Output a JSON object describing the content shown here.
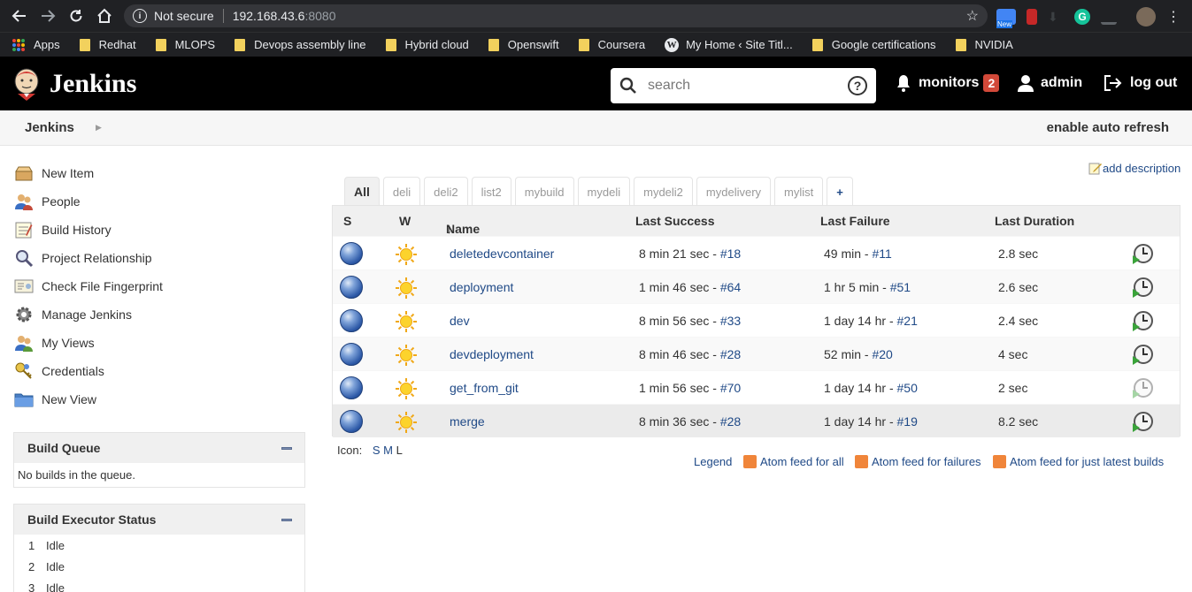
{
  "browser": {
    "security_label": "Not secure",
    "url_host": "192.168.43.6",
    "url_port": ":8080",
    "bookmarks": [
      {
        "label": "Apps",
        "icon": "apps-grid-icon"
      },
      {
        "label": "Redhat",
        "icon": "folder-icon"
      },
      {
        "label": "MLOPS",
        "icon": "folder-icon"
      },
      {
        "label": "Devops assembly line",
        "icon": "folder-icon"
      },
      {
        "label": "Hybrid cloud",
        "icon": "folder-icon"
      },
      {
        "label": "Openswift",
        "icon": "folder-icon"
      },
      {
        "label": "Coursera",
        "icon": "folder-icon"
      },
      {
        "label": "My Home ‹ Site Titl...",
        "icon": "wordpress-icon"
      },
      {
        "label": "Google certifications",
        "icon": "folder-icon"
      },
      {
        "label": "NVIDIA",
        "icon": "folder-icon"
      }
    ],
    "ext_new_label": "New"
  },
  "header": {
    "title": "Jenkins",
    "search_placeholder": "search",
    "help_glyph": "?",
    "monitors_label": "monitors",
    "monitors_count": "2",
    "user_label": "admin",
    "logout_label": "log out"
  },
  "breadcrumb": {
    "root": "Jenkins",
    "auto_refresh": "enable auto refresh"
  },
  "sidebar": {
    "tasks": [
      {
        "label": "New Item",
        "icon": "new-item-icon"
      },
      {
        "label": "People",
        "icon": "people-icon"
      },
      {
        "label": "Build History",
        "icon": "build-history-icon"
      },
      {
        "label": "Project Relationship",
        "icon": "magnifier-icon"
      },
      {
        "label": "Check File Fingerprint",
        "icon": "fingerprint-icon"
      },
      {
        "label": "Manage Jenkins",
        "icon": "gear-icon"
      },
      {
        "label": "My Views",
        "icon": "my-views-icon"
      },
      {
        "label": "Credentials",
        "icon": "credentials-icon"
      },
      {
        "label": "New View",
        "icon": "folder-icon"
      }
    ],
    "build_queue": {
      "title": "Build Queue",
      "empty": "No builds in the queue."
    },
    "executors": {
      "title": "Build Executor Status",
      "rows": [
        {
          "num": "1",
          "status": "Idle"
        },
        {
          "num": "2",
          "status": "Idle"
        },
        {
          "num": "3",
          "status": "Idle"
        }
      ]
    }
  },
  "main": {
    "add_description": "add description",
    "tabs": [
      "All",
      "deli",
      "deli2",
      "list2",
      "mybuild",
      "mydeli",
      "mydeli2",
      "mydelivery",
      "mylist",
      "+"
    ],
    "columns": {
      "s": "S",
      "w": "W",
      "name": "Name",
      "sort_arrow": "↓",
      "last_success": "Last Success",
      "last_failure": "Last Failure",
      "last_duration": "Last Duration"
    },
    "jobs": [
      {
        "name": "deletedevcontainer",
        "success": "8 min 21 sec - ",
        "success_build": "#18",
        "failure": "49 min - ",
        "failure_build": "#11",
        "duration": "2.8 sec"
      },
      {
        "name": "deployment",
        "success": "1 min 46 sec - ",
        "success_build": "#64",
        "failure": "1 hr 5 min - ",
        "failure_build": "#51",
        "duration": "2.6 sec"
      },
      {
        "name": "dev",
        "success": "8 min 56 sec - ",
        "success_build": "#33",
        "failure": "1 day 14 hr - ",
        "failure_build": "#21",
        "duration": "2.4 sec"
      },
      {
        "name": "devdeployment",
        "success": "8 min 46 sec - ",
        "success_build": "#28",
        "failure": "52 min - ",
        "failure_build": "#20",
        "duration": "4 sec"
      },
      {
        "name": "get_from_git",
        "success": "1 min 56 sec - ",
        "success_build": "#70",
        "failure": "1 day 14 hr - ",
        "failure_build": "#50",
        "duration": "2 sec"
      },
      {
        "name": "merge",
        "success": "8 min 36 sec - ",
        "success_build": "#28",
        "failure": "1 day 14 hr - ",
        "failure_build": "#19",
        "duration": "8.2 sec"
      }
    ],
    "icon_size": {
      "label": "Icon:",
      "s": "S",
      "m": "M",
      "l": "L"
    },
    "footer_links": {
      "legend": "Legend",
      "feed_all": "Atom feed for all",
      "feed_failures": "Atom feed for failures",
      "feed_latest": "Atom feed for just latest builds"
    }
  },
  "colors": {
    "browser_bg": "#202124",
    "header_bg": "#000000",
    "link": "#204a87",
    "badge": "#d24939",
    "ball_blue": "#2e5aa8",
    "sun": "#f5c518"
  }
}
